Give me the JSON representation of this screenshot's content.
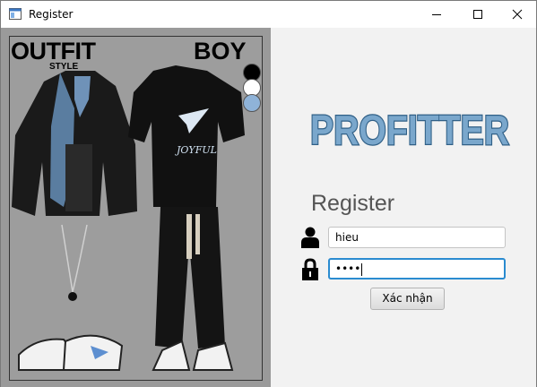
{
  "window": {
    "title": "Register",
    "icon": "window-app-icon",
    "controls": [
      "minimize-icon",
      "maximize-icon",
      "close-icon"
    ]
  },
  "poster": {
    "title_left": "OUTFIT",
    "title_right": "BOY",
    "subtitle": "STYLE",
    "shirt_print": "JOYFUL",
    "swatch_colors": [
      "#000000",
      "#ffffff",
      "#8fb3d8"
    ]
  },
  "form": {
    "logo_text": "PROFITTER",
    "heading": "Register",
    "username_value": "hieu",
    "password_mask": "••••",
    "submit_label": "Xác nhận",
    "user_icon": "user-icon",
    "lock_icon": "lock-icon"
  },
  "colors": {
    "logo_fill": "#7aa7cc",
    "logo_outline": "#2f5f86",
    "focus_border": "#2a8bd0"
  }
}
